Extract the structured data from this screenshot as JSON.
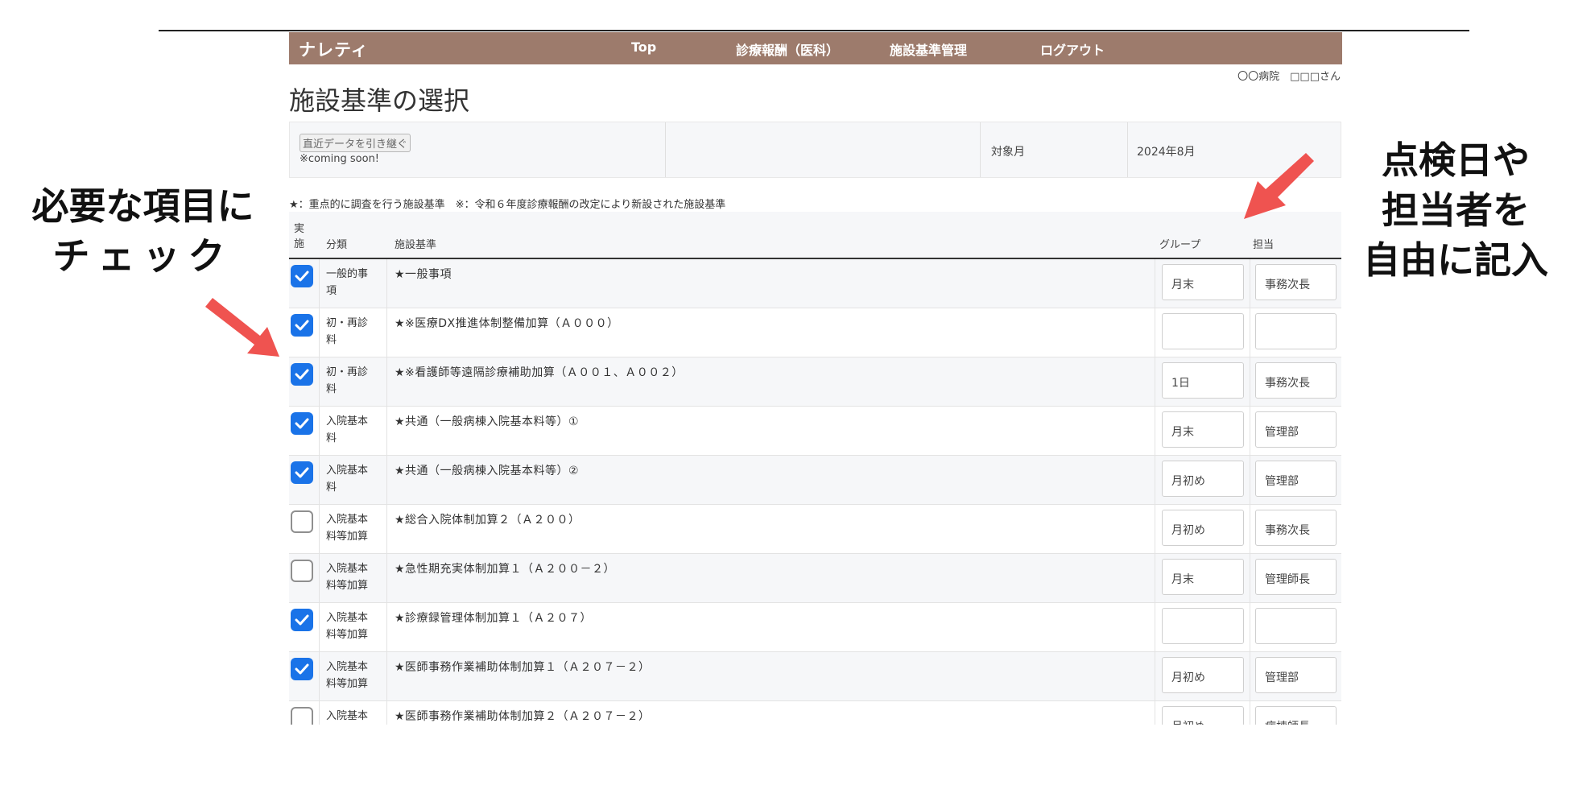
{
  "nav": {
    "brand": "ナレティ",
    "links": [
      "Top",
      "診療報酬（医科）",
      "施設基準管理",
      "ログアウト"
    ]
  },
  "user": "〇〇病院　□□□さん",
  "page_title": "施設基準の選択",
  "filter": {
    "inherit_button": "直近データを引き継ぐ",
    "coming_soon": "※coming soon!",
    "month_label": "対象月",
    "month_value": "2024年8月"
  },
  "legend": "★：重点的に調査を行う施設基準　※：令和６年度診療報酬の改定により新設された施設基準",
  "table": {
    "headers": {
      "done_line1": "実",
      "done_line2": "施",
      "category": "分類",
      "standard": "施設基準",
      "group": "グループ",
      "owner": "担当"
    },
    "rows": [
      {
        "checked": true,
        "category": "一般的事項",
        "standard": "★一般事項",
        "group": "月末",
        "owner": "事務次長"
      },
      {
        "checked": true,
        "category": "初・再診料",
        "standard": "★※医療DX推進体制整備加算（Ａ０００）",
        "group": "",
        "owner": ""
      },
      {
        "checked": true,
        "category": "初・再診料",
        "standard": "★※看護師等遠隔診療補助加算（Ａ００１、Ａ００２）",
        "group": "1日",
        "owner": "事務次長"
      },
      {
        "checked": true,
        "category": "入院基本料",
        "standard": "★共通（一般病棟入院基本料等）①",
        "group": "月末",
        "owner": "管理部"
      },
      {
        "checked": true,
        "category": "入院基本料",
        "standard": "★共通（一般病棟入院基本料等）②",
        "group": "月初め",
        "owner": "管理部"
      },
      {
        "checked": false,
        "category": "入院基本料等加算",
        "standard": "★総合入院体制加算２（Ａ２００）",
        "group": "月初め",
        "owner": "事務次長"
      },
      {
        "checked": false,
        "category": "入院基本料等加算",
        "standard": "★急性期充実体制加算１（Ａ２００－２）",
        "group": "月末",
        "owner": "管理師長"
      },
      {
        "checked": true,
        "category": "入院基本料等加算",
        "standard": "★診療録管理体制加算１（Ａ２０７）",
        "group": "",
        "owner": ""
      },
      {
        "checked": true,
        "category": "入院基本料等加算",
        "standard": "★医師事務作業補助体制加算１（Ａ２０７－２）",
        "group": "月初め",
        "owner": "管理部"
      },
      {
        "checked": false,
        "category": "入院基本料等加算",
        "standard": "★医師事務作業補助体制加算２（Ａ２０７－２）",
        "group": "月初め",
        "owner": "病棟師長"
      }
    ]
  },
  "callouts": {
    "left": [
      "必要な項目に",
      "チェック"
    ],
    "right": [
      "点検日や",
      "担当者を",
      "自由に記入"
    ],
    "arrow_color": "#ef5350"
  },
  "colors": {
    "nav": "#9d7b6c",
    "checkbox": "#1a73e8"
  }
}
